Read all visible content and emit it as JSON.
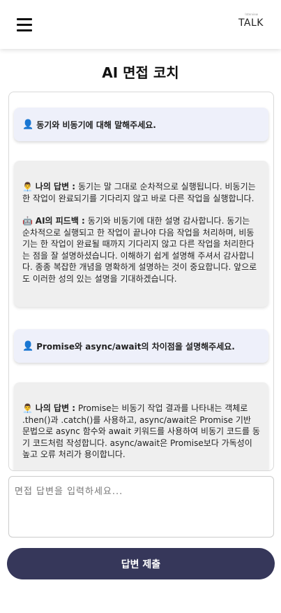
{
  "header": {
    "logo": "TALK",
    "logo_small": "Interview"
  },
  "page_title": "AI 면접 코치",
  "messages": [
    {
      "type": "question",
      "icon": "👤",
      "text": "동기와 비동기에 대해 말해주세요."
    },
    {
      "type": "answer",
      "icon_answer": "👨‍💼",
      "label_answer": "나의 답변 :",
      "answer": "동기는 말 그대로 순차적으로 실행됩니다. 비동기는 한 작업이 완료되기를 기다리지 않고 바로 다른 작업을 실행합니다.",
      "icon_feedback": "🤖",
      "label_feedback": "AI의 피드백 :",
      "feedback": "동기와 비동기에 대한 설명 감사합니다. 동기는 순차적으로 실행되고 한 작업이 끝나야 다음 작업을 처리하며, 비동기는 한 작업이 완료될 때까지 기다리지 않고 다른 작업을 처리한다는 점을 잘 설명하셨습니다. 이해하기 쉽게 설명해 주셔서 감사합니다. 종종 복잡한 개념을 명확하게 설명하는 것이 중요합니다. 앞으로도 이러한 성의 있는 설명을 기대하겠습니다."
    },
    {
      "type": "question",
      "icon": "👤",
      "text": "Promise와 async/await의 차이점을 설명해주세요."
    },
    {
      "type": "answer",
      "icon_answer": "👨‍💼",
      "label_answer": "나의 답변 :",
      "answer": "Promise는 비동기 작업 결과를 나타내는 객체로 .then()과 .catch()를 사용하고, async/await은 Promise 기반 문법으로 async 함수와 await 키워드를 사용하여 비동기 코드를 동기 코드처럼 작성합니다. async/await은 Promise보다 가독성이 높고 오류 처리가 용이합니다."
    }
  ],
  "input": {
    "placeholder": "면접 답변을 입력하세요...",
    "value": ""
  },
  "submit_label": "답변 제출"
}
